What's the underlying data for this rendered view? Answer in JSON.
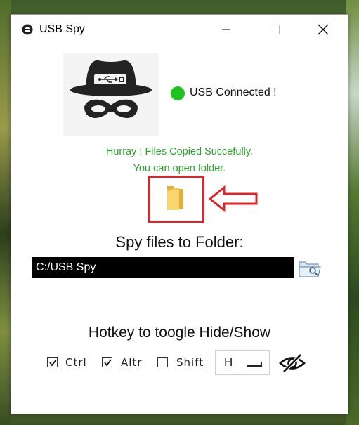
{
  "window": {
    "title": "USB Spy",
    "controls": [
      "minimize",
      "maximize",
      "close"
    ]
  },
  "status": {
    "text": "USB Connected !",
    "color": "#1fc21f"
  },
  "messages": {
    "line1": "Hurray ! Files Copied Succefully.",
    "line2": "You can open folder.",
    "color": "#2ea32e"
  },
  "destination": {
    "label": "Spy files to Folder:",
    "path": "C:/USB Spy"
  },
  "hotkey": {
    "label": "Hotkey to toogle Hide/Show",
    "modifiers": [
      {
        "label": "Ctrl",
        "checked": true
      },
      {
        "label": "Altr",
        "checked": true
      },
      {
        "label": "Shift",
        "checked": false
      }
    ],
    "key": "H"
  },
  "icons": {
    "app": "spy-app-icon",
    "logo": "spy-usb-logo",
    "open_folder": "folder-icon",
    "browse": "folder-browse-icon",
    "visibility": "eye-slash-icon",
    "annotation_color": "#e0242a"
  }
}
